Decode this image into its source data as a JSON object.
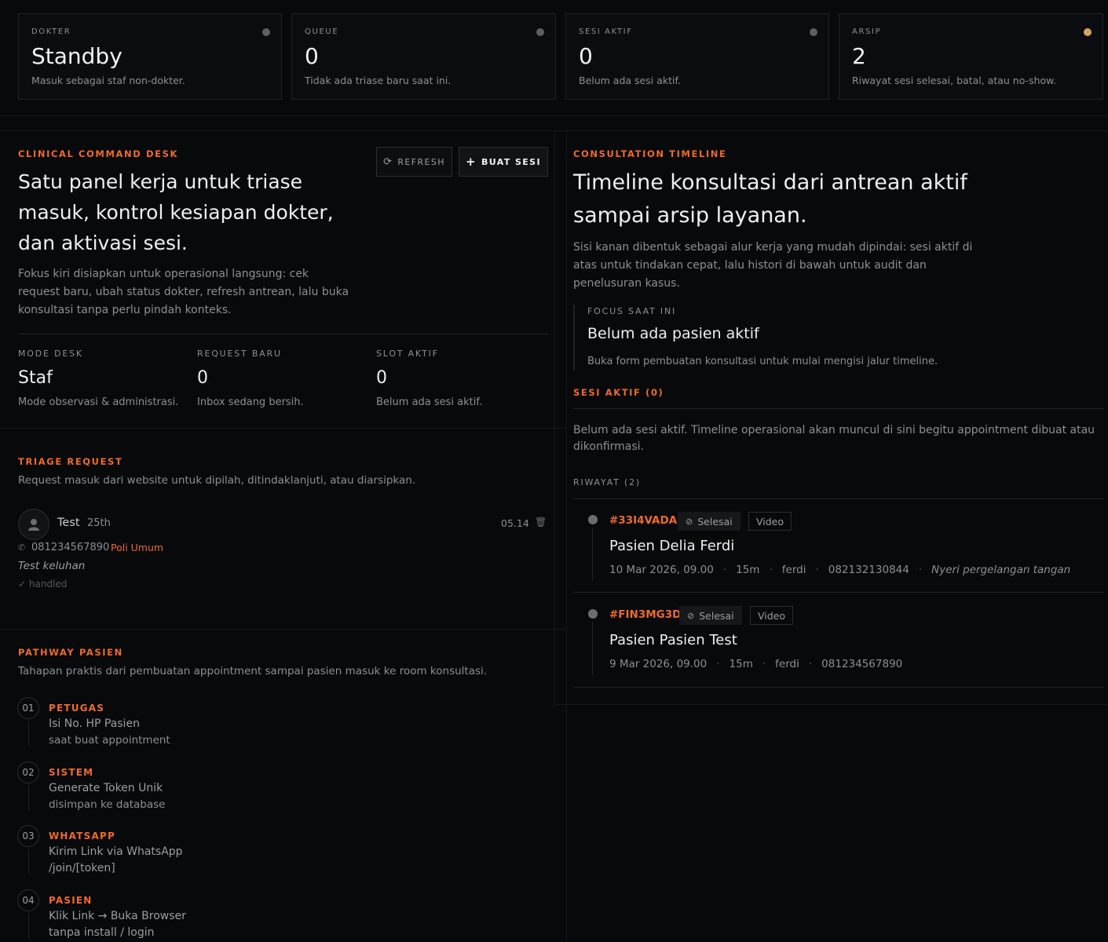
{
  "stats": [
    {
      "label": "DOKTER",
      "value": "Standby",
      "sub": "Masuk sebagai staf non-dokter."
    },
    {
      "label": "QUEUE",
      "value": "0",
      "sub": "Tidak ada triase baru saat ini."
    },
    {
      "label": "SESI AKTIF",
      "value": "0",
      "sub": "Belum ada sesi aktif."
    },
    {
      "label": "ARSIP",
      "value": "2",
      "sub": "Riwayat sesi selesai, batal, atau no-show."
    }
  ],
  "command_desk": {
    "eyebrow": "CLINICAL COMMAND DESK",
    "title_line1": "Satu panel kerja untuk triase",
    "title_line2": "masuk, kontrol kesiapan dokter,",
    "title_line3": "dan aktivasi sesi.",
    "desc_line1": "Fokus kiri disiapkan untuk operasional langsung: cek",
    "desc_line2": "request baru, ubah status dokter, refresh antrean, lalu buka",
    "desc_line3": "konsultasi tanpa perlu pindah konteks.",
    "refresh_label": "REFRESH",
    "create_label": "BUAT SESI",
    "metrics": [
      {
        "label": "MODE DESK",
        "value": "Staf",
        "sub": "Mode observasi & administrasi."
      },
      {
        "label": "REQUEST BARU",
        "value": "0",
        "sub": "Inbox sedang bersih."
      },
      {
        "label": "SLOT AKTIF",
        "value": "0",
        "sub": "Belum ada sesi aktif."
      }
    ]
  },
  "triage": {
    "eyebrow": "TRIAGE REQUEST",
    "desc": "Request masuk dari website untuk dipilah, ditindaklanjuti, atau diarsipkan.",
    "request": {
      "name": "Test",
      "date": "25th",
      "time": "05.14",
      "phone": "081234567890",
      "poli": "Poli Umum",
      "complaint": "Test keluhan",
      "status": "✓ handled"
    }
  },
  "pathway": {
    "eyebrow": "PATHWAY PASIEN",
    "desc": "Tahapan praktis dari pembuatan appointment sampai pasien masuk ke room konsultasi.",
    "steps": [
      {
        "num": "01",
        "label": "PETUGAS",
        "line1": "Isi No. HP Pasien",
        "line2": "saat buat appointment"
      },
      {
        "num": "02",
        "label": "SISTEM",
        "line1": "Generate Token Unik",
        "line2": "disimpan ke database"
      },
      {
        "num": "03",
        "label": "WHATSAPP",
        "line1": "Kirim Link via WhatsApp",
        "line2": "/join/[token]"
      },
      {
        "num": "04",
        "label": "PASIEN",
        "line1": "Klik Link → Buka Browser",
        "line2": "tanpa install / login"
      }
    ]
  },
  "timeline": {
    "eyebrow": "CONSULTATION TIMELINE",
    "title_line1": "Timeline konsultasi dari antrean aktif",
    "title_line2": "sampai arsip layanan.",
    "desc_line1": "Sisi kanan dibentuk sebagai alur kerja yang mudah dipindai: sesi aktif di",
    "desc_line2": "atas untuk tindakan cepat, lalu histori di bawah untuk audit dan",
    "desc_line3": "penelusuran kasus.",
    "focus_label": "FOCUS SAAT INI",
    "focus_title": "Belum ada pasien aktif",
    "focus_desc": "Buka form pembuatan konsultasi untuk mulai mengisi jalur timeline.",
    "active_label": "SESI AKTIF (0)",
    "active_empty_line1": "Belum ada sesi aktif. Timeline operasional akan muncul di sini begitu appointment dibuat atau",
    "active_empty_line2": "dikonfirmasi.",
    "history_label": "RIWAYAT (2)",
    "history": [
      {
        "code": "#33I4VADA",
        "status": "Selesai",
        "type": "Video",
        "name": "Pasien Delia Ferdi",
        "date": "10 Mar 2026, 09.00",
        "duration": "15m",
        "doctor": "ferdi",
        "phone": "082132130844",
        "note": "Nyeri pergelangan tangan"
      },
      {
        "code": "#FIN3MG3D",
        "status": "Selesai",
        "type": "Video",
        "name": "Pasien Pasien Test",
        "date": "9 Mar 2026, 09.00",
        "duration": "15m",
        "doctor": "ferdi",
        "phone": "081234567890",
        "note": ""
      }
    ]
  }
}
